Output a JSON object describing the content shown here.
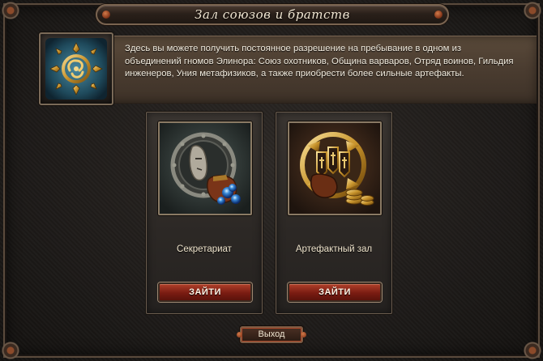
{
  "window": {
    "title": "Зал союзов и братств"
  },
  "info": {
    "text": "Здесь вы можете получить постоянное разрешение на пребывание в одном из объединений гномов Элинора: Союз охотников, Община варваров, Отряд воинов, Гильдия инженеров, Уния метафизиков, а также приобрести более сильные артефакты.",
    "emblem_icon": "alliance-emblem-icon"
  },
  "cards": [
    {
      "label": "Секретариат",
      "button": "ЗАЙТИ",
      "art_icon": "secretariat-art-icon"
    },
    {
      "label": "Артефактный зал",
      "button": "ЗАЙТИ",
      "art_icon": "artifact-hall-art-icon"
    }
  ],
  "footer": {
    "exit_label": "Выход"
  },
  "colors": {
    "accent_red": "#8a2214",
    "panel_brown": "#4a3c30",
    "text_light": "#f2ecdf"
  }
}
